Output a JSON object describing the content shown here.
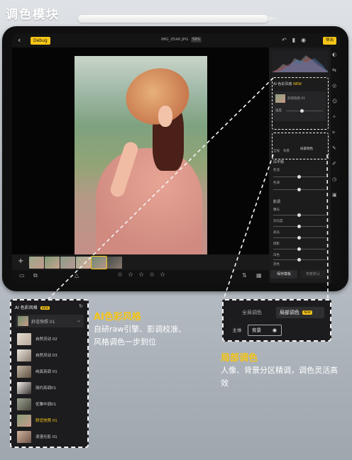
{
  "page": {
    "title": "调色模块"
  },
  "toolbar": {
    "back_icon": "chevron-left-icon",
    "debug_label": "Debug",
    "filename": "IMG_0546.JPG",
    "zoom": "59%",
    "export_label": "导出"
  },
  "right_panel": {
    "ai_header": "AI 色彩风格",
    "ai_new": "NEW",
    "ai_selected": "舒适快照 01",
    "strength_label": "强度",
    "tab_global": "全局",
    "tab_bg": "背景",
    "tab_local": "局部调色",
    "section_wb": "白平衡",
    "wb_temp": "色温",
    "wb_tint": "色调",
    "section_shadows": "影调",
    "sliders": [
      "曝光",
      "对比度",
      "高光",
      "阴影",
      "白色",
      "黑色"
    ],
    "save_label": "保存模板",
    "reset_label": "恢复默认"
  },
  "ai_panel": {
    "header": "AI 色彩风格",
    "badge": "NEW",
    "selected": "舒适快照 01",
    "items": [
      {
        "label": "自然灵动 02",
        "active": false
      },
      {
        "label": "自然灵动 03",
        "active": false
      },
      {
        "label": "纯真亮调 01",
        "active": false
      },
      {
        "label": "简约亮调01",
        "active": false
      },
      {
        "label": "优雅中调01",
        "active": false
      },
      {
        "label": "舒适快照 01",
        "active": true
      },
      {
        "label": "浪漫光影 01",
        "active": false
      }
    ]
  },
  "ai_callout": {
    "title": "AI色彩风格",
    "desc": "自研raw引擎、影调校准、风格调色一步到位"
  },
  "local_panel": {
    "tab_global": "全局调色",
    "tab_local": "局部调色",
    "badge": "NEW",
    "chip_subject": "主体",
    "chip_background": "背景"
  },
  "local_callout": {
    "title": "局部调色",
    "desc": "人像、背景分区精调，调色灵活高效"
  },
  "colors": {
    "accent": "#f5c518"
  }
}
